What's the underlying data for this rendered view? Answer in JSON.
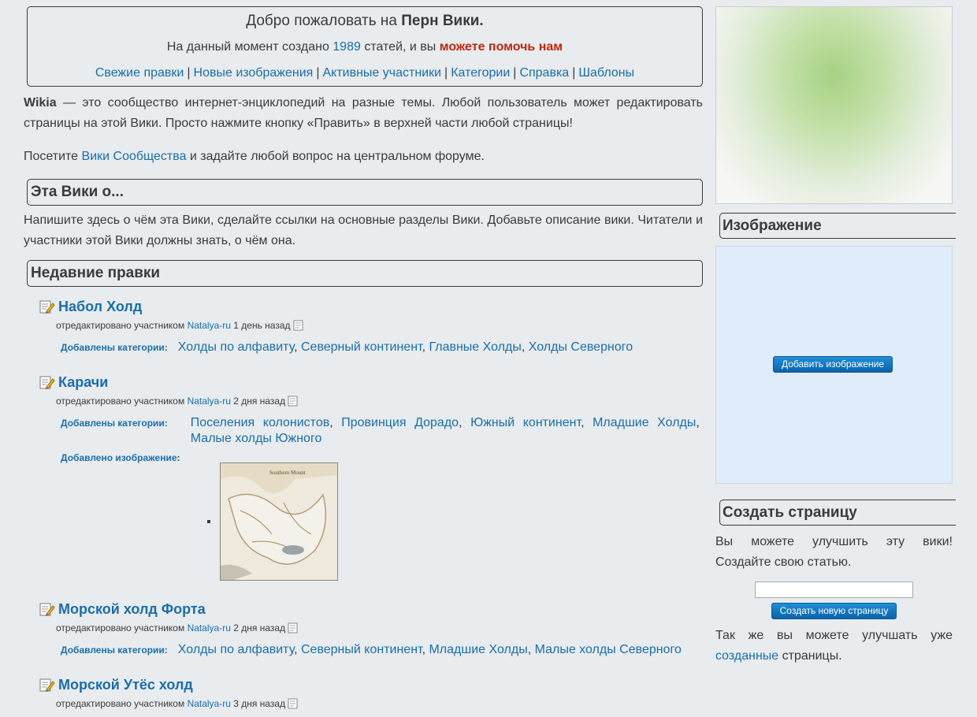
{
  "welcome": {
    "title_prefix": "Добро пожаловать на ",
    "title_bold": "Перн Вики.",
    "stats_prefix": "На данный момент создано ",
    "stats_count": "1989",
    "stats_mid": " статей, и вы ",
    "stats_help": "можете помочь нам",
    "links": [
      "Свежие правки",
      "Новые изображения",
      "Активные участники",
      "Категории",
      "Справка",
      "Шаблоны"
    ],
    "separator": "|"
  },
  "intro": {
    "wikia_bold": "Wikia",
    "wikia_text": " — это сообщество интернет-энциклопедий на разные темы. Любой пользователь может редактировать страницы на этой Вики. Просто нажмите кнопку «Править» в верхней части любой страницы!",
    "visit_prefix": "Посетите ",
    "visit_link": "Вики Сообщества",
    "visit_suffix": " и задайте любой вопрос на центральном форуме."
  },
  "about": {
    "heading": "Эта Вики о...",
    "text": "Напишите здесь о чём эта Вики, сделайте ссылки на основные разделы Вики. Добавьте описание вики. Читатели и участники этой Вики должны знать, о чём она."
  },
  "recent": {
    "heading": "Недавние правки",
    "edited_by": "отредактировано участником",
    "cats_label": "Добавлены категории:",
    "image_label": "Добавлено изображение",
    "items": [
      {
        "title": "Набол Холд",
        "user": "Natalya-ru",
        "when": "1 день назад",
        "cats": [
          "Холды по алфавиту",
          "Северный континент",
          "Главные Холды",
          "Холды Северного"
        ]
      },
      {
        "title": "Карачи",
        "user": "Natalya-ru",
        "when": "2 дня назад",
        "cats": [
          "Поселения колонистов",
          "Провинция Дорадо",
          "Южный континент",
          "Младшие Холды",
          "Малые холды Южного"
        ],
        "map_text": "Southern Mount"
      },
      {
        "title": "Морской холд Форта",
        "user": "Natalya-ru",
        "when": "2 дня назад",
        "cats": [
          "Холды по алфавиту",
          "Северный континент",
          "Младшие Холды",
          "Малые холды Северного"
        ]
      },
      {
        "title": "Морской Утёс холд",
        "user": "Natalya-ru",
        "when": "3 дня назад"
      }
    ]
  },
  "sidebar": {
    "image_heading": "Изображение",
    "add_image_btn": "Добавить изображение",
    "create_heading": "Создать страницу",
    "create_text": "Вы можете улучшить эту вики! Создайте свою статью.",
    "create_btn": "Создать новую страницу",
    "improve_prefix": "Так же вы можете улучшать уже ",
    "improve_link": "созданные",
    "improve_suffix": " страницы."
  },
  "colors": {
    "link": "#1a6dab",
    "help": "#c0260f",
    "background": "#e8ecef",
    "button": "#0a63aa"
  }
}
